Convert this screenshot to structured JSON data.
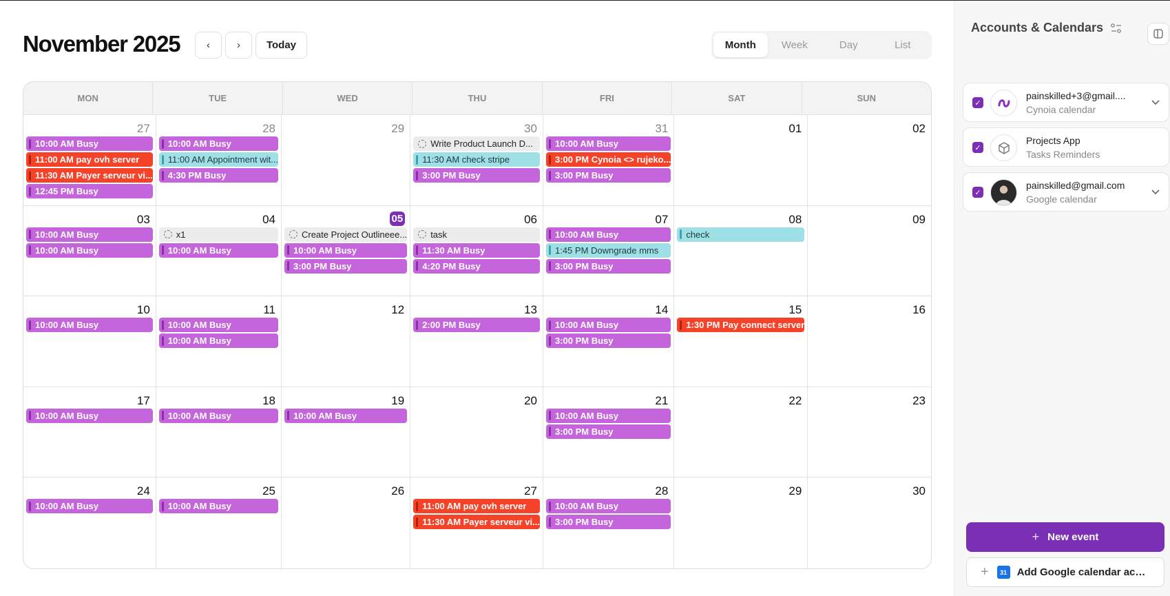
{
  "header": {
    "title": "November 2025",
    "prev_label": "‹",
    "next_label": "›",
    "today_label": "Today",
    "views": [
      "Month",
      "Week",
      "Day",
      "List"
    ],
    "active_view": "Month"
  },
  "calendar": {
    "weekdays": [
      "MON",
      "TUE",
      "WED",
      "THU",
      "FRI",
      "SAT",
      "SUN"
    ],
    "cells": [
      {
        "day": "27",
        "muted": true,
        "events": [
          {
            "text": "10:00 AM Busy",
            "color": "purple"
          },
          {
            "text": "11:00 AM pay ovh server",
            "color": "red"
          },
          {
            "text": "11:30 AM Payer serveur vi...",
            "color": "red"
          },
          {
            "text": "12:45 PM Busy",
            "color": "purple"
          }
        ]
      },
      {
        "day": "28",
        "muted": true,
        "events": [
          {
            "text": "10:00 AM Busy",
            "color": "purple"
          },
          {
            "text": "11:00 AM Appointment wit...",
            "color": "cyan"
          },
          {
            "text": "4:30 PM Busy",
            "color": "purple"
          }
        ]
      },
      {
        "day": "29",
        "muted": true,
        "events": []
      },
      {
        "day": "30",
        "muted": true,
        "events": [
          {
            "text": "Write Product Launch D...",
            "color": "gray"
          },
          {
            "text": "11:30 AM check stripe",
            "color": "cyan"
          },
          {
            "text": "3:00 PM Busy",
            "color": "purple"
          }
        ]
      },
      {
        "day": "31",
        "muted": true,
        "events": [
          {
            "text": "10:00 AM Busy",
            "color": "purple"
          },
          {
            "text": "3:00 PM Cynoia <> rujeko...",
            "color": "red"
          },
          {
            "text": "3:00 PM Busy",
            "color": "purple"
          }
        ]
      },
      {
        "day": "01",
        "events": []
      },
      {
        "day": "02",
        "events": []
      },
      {
        "day": "03",
        "events": [
          {
            "text": "10:00 AM Busy",
            "color": "purple"
          },
          {
            "text": "10:00 AM Busy",
            "color": "purple"
          }
        ]
      },
      {
        "day": "04",
        "events": [
          {
            "text": "x1",
            "color": "gray"
          },
          {
            "text": "10:00 AM Busy",
            "color": "purple"
          }
        ]
      },
      {
        "day": "05",
        "today": true,
        "events": [
          {
            "text": "Create Project Outlineee...",
            "color": "gray"
          },
          {
            "text": "10:00 AM Busy",
            "color": "purple"
          },
          {
            "text": "3:00 PM Busy",
            "color": "purple"
          }
        ]
      },
      {
        "day": "06",
        "events": [
          {
            "text": "task",
            "color": "gray"
          },
          {
            "text": "11:30 AM Busy",
            "color": "purple"
          },
          {
            "text": "4:20 PM Busy",
            "color": "purple"
          }
        ]
      },
      {
        "day": "07",
        "events": [
          {
            "text": "10:00 AM Busy",
            "color": "purple"
          },
          {
            "text": "1:45 PM Downgrade mms",
            "color": "cyan"
          },
          {
            "text": "3:00 PM Busy",
            "color": "purple"
          }
        ]
      },
      {
        "day": "08",
        "events": [
          {
            "text": "check",
            "color": "cyan"
          }
        ]
      },
      {
        "day": "09",
        "events": []
      },
      {
        "day": "10",
        "events": [
          {
            "text": "10:00 AM Busy",
            "color": "purple"
          }
        ]
      },
      {
        "day": "11",
        "events": [
          {
            "text": "10:00 AM Busy",
            "color": "purple"
          },
          {
            "text": "10:00 AM Busy",
            "color": "purple"
          }
        ]
      },
      {
        "day": "12",
        "events": []
      },
      {
        "day": "13",
        "events": [
          {
            "text": "2:00 PM Busy",
            "color": "purple"
          }
        ]
      },
      {
        "day": "14",
        "events": [
          {
            "text": "10:00 AM Busy",
            "color": "purple"
          },
          {
            "text": "3:00 PM Busy",
            "color": "purple"
          }
        ]
      },
      {
        "day": "15",
        "events": [
          {
            "text": "1:30 PM Pay connect server",
            "color": "red"
          }
        ]
      },
      {
        "day": "16",
        "events": []
      },
      {
        "day": "17",
        "events": [
          {
            "text": "10:00 AM Busy",
            "color": "purple"
          }
        ]
      },
      {
        "day": "18",
        "events": [
          {
            "text": "10:00 AM Busy",
            "color": "purple"
          }
        ]
      },
      {
        "day": "19",
        "events": [
          {
            "text": "10:00 AM Busy",
            "color": "purple"
          }
        ]
      },
      {
        "day": "20",
        "events": []
      },
      {
        "day": "21",
        "events": [
          {
            "text": "10:00 AM Busy",
            "color": "purple"
          },
          {
            "text": "3:00 PM Busy",
            "color": "purple"
          }
        ]
      },
      {
        "day": "22",
        "events": []
      },
      {
        "day": "23",
        "events": []
      },
      {
        "day": "24",
        "events": [
          {
            "text": "10:00 AM Busy",
            "color": "purple"
          }
        ]
      },
      {
        "day": "25",
        "events": [
          {
            "text": "10:00 AM Busy",
            "color": "purple"
          }
        ]
      },
      {
        "day": "26",
        "events": []
      },
      {
        "day": "27",
        "events": [
          {
            "text": "11:00 AM pay ovh server",
            "color": "red"
          },
          {
            "text": "11:30 AM Payer serveur vi...",
            "color": "red"
          }
        ]
      },
      {
        "day": "28",
        "events": [
          {
            "text": "10:00 AM Busy",
            "color": "purple"
          },
          {
            "text": "3:00 PM Busy",
            "color": "purple"
          }
        ]
      },
      {
        "day": "29",
        "events": []
      },
      {
        "day": "30",
        "events": []
      }
    ]
  },
  "sidebar": {
    "title": "Accounts & Calendars",
    "accounts": [
      {
        "name": "painskilled+3@gmail....",
        "sub": "Cynoia calendar",
        "avatar": "cynoia-logo-icon",
        "expandable": true
      },
      {
        "name": "Projects App",
        "sub": "Tasks Reminders",
        "avatar": "cube-icon",
        "expandable": false
      },
      {
        "name": "painskilled@gmail.com",
        "sub": "Google calendar",
        "avatar": "user-photo",
        "expandable": true
      }
    ],
    "new_event_label": "New event",
    "add_google_label": "Add Google calendar acc...",
    "google_icon_text": "31"
  },
  "colors": {
    "accent": "#7b2fb5",
    "event_purple": "#c565dc",
    "event_red": "#f5432a",
    "event_cyan": "#9ee0e6",
    "task_gray": "#ececec"
  }
}
